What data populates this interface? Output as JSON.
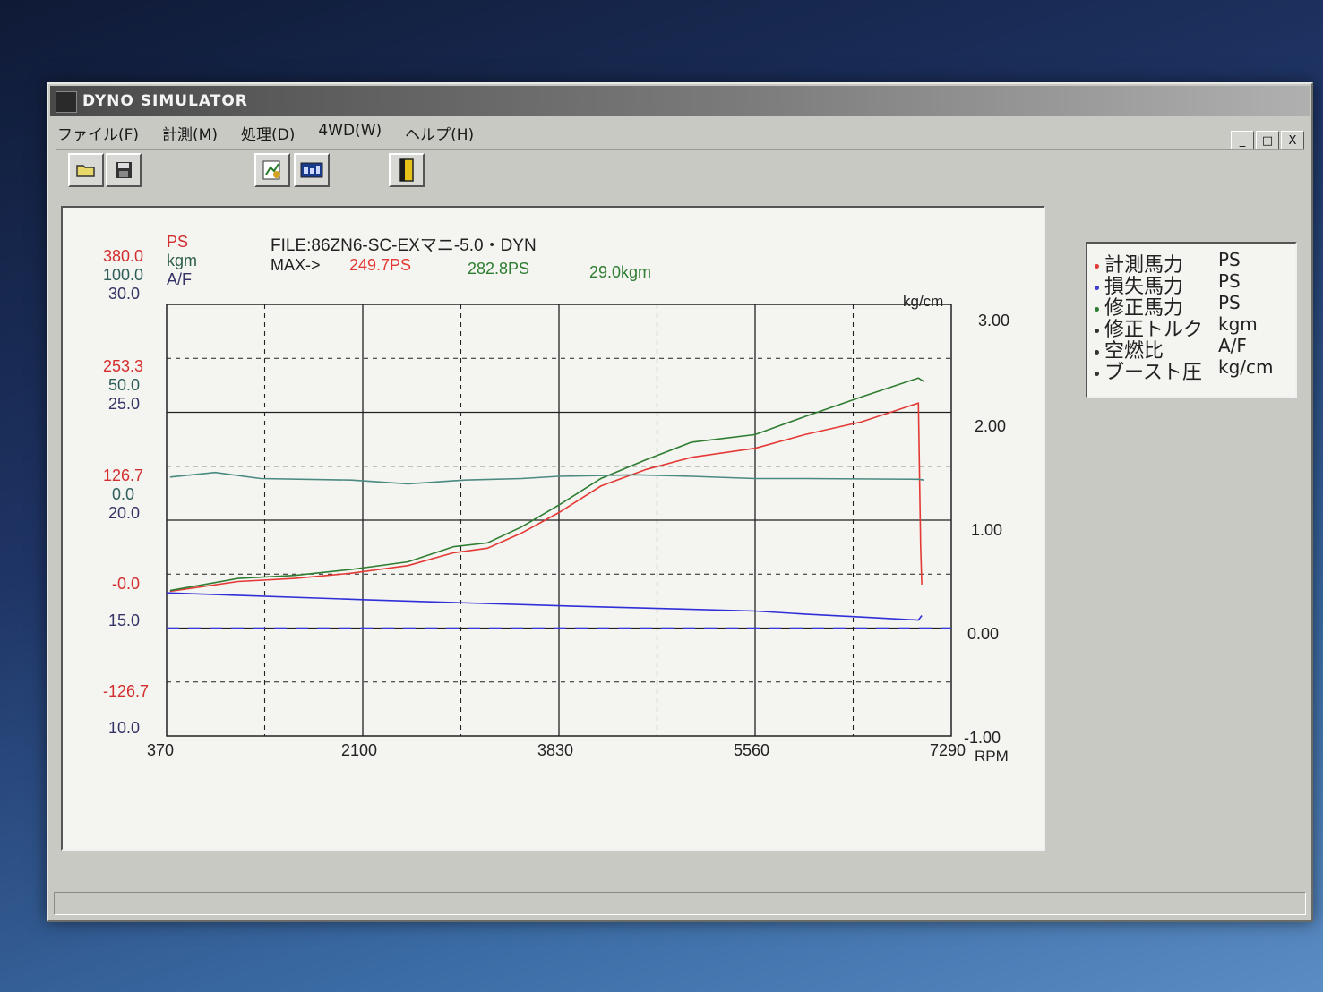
{
  "window": {
    "title": "DYNO SIMULATOR",
    "controls": {
      "minimize": "_",
      "maximize": "□",
      "close": "X"
    }
  },
  "menu": [
    "ファイル(F)",
    "計測(M)",
    "処理(D)",
    "4WD(W)",
    "ヘルプ(H)"
  ],
  "toolbar": {
    "buttons": [
      "open-folder-icon",
      "save-disk-icon",
      "measure-icon",
      "monitor-icon",
      "exit-door-icon"
    ]
  },
  "header": {
    "file_line": "FILE:86ZN6-SC-EXマニ-5.0・DYN",
    "max_label": "MAX->",
    "max_measured": "249.7PS",
    "max_corrected": "282.8PS",
    "max_torque": "29.0kgm"
  },
  "left_axis": {
    "units": [
      "PS",
      "kgm",
      "A/F"
    ],
    "ps": [
      "380.0",
      "253.3",
      "126.7",
      "-0.0",
      "-126.7"
    ],
    "kgm": [
      "100.0",
      "50.0",
      "0.0"
    ],
    "af": [
      "30.0",
      "25.0",
      "20.0",
      "15.0",
      "10.0"
    ]
  },
  "right_axis": {
    "unit": "kg/cm",
    "ticks": [
      "3.00",
      "2.00",
      "1.00",
      "0.00",
      "-1.00"
    ],
    "x_unit": "RPM"
  },
  "legend": [
    {
      "name": "計測馬力",
      "unit": "PS",
      "color": "#e53935"
    },
    {
      "name": "損失馬力",
      "unit": "PS",
      "color": "#3b3bd6"
    },
    {
      "name": "修正馬力",
      "unit": "PS",
      "color": "#2e7d32"
    },
    {
      "name": "修正トルク",
      "unit": "kgm",
      "color": "#333333"
    },
    {
      "name": "空燃比",
      "unit": "A/F",
      "color": "#333333"
    },
    {
      "name": "ブースト圧",
      "unit": "kg/cm",
      "color": "#333333"
    }
  ],
  "colors": {
    "measured": "#e53935",
    "corrected": "#2e7d32",
    "loss": "#2f2fd8",
    "boost": "#3a3ae0",
    "torque_af": "#4a8a80",
    "ps_labels": "#d32f2f",
    "kgm_labels": "#2e7d5a",
    "af_labels": "#333366"
  },
  "chart_data": {
    "type": "line",
    "x_label": "RPM",
    "x_ticks": [
      "370",
      "2100",
      "3830",
      "5560",
      "7290"
    ],
    "xlim": [
      370,
      7290
    ],
    "ylim_ps": [
      -190,
      380
    ],
    "ylim_boost": [
      -1.0,
      3.0
    ],
    "series": [
      {
        "name": "計測馬力",
        "unit": "PS",
        "x": [
          400,
          1000,
          1500,
          2000,
          2500,
          2900,
          3200,
          3500,
          3830,
          4200,
          4600,
          5000,
          5560,
          6000,
          6500,
          7000,
          7020,
          7030
        ],
        "y": [
          1,
          14,
          18,
          25,
          35,
          52,
          58,
          78,
          105,
          140,
          162,
          178,
          190,
          208,
          225,
          249.7,
          60,
          10
        ]
      },
      {
        "name": "修正馬力",
        "unit": "PS",
        "x": [
          400,
          1000,
          1500,
          2000,
          2500,
          2900,
          3200,
          3500,
          3830,
          4200,
          4600,
          5000,
          5560,
          6000,
          6500,
          7000,
          7050
        ],
        "y": [
          2,
          18,
          22,
          30,
          40,
          60,
          65,
          86,
          115,
          150,
          175,
          198,
          208,
          232,
          258,
          282.8,
          278
        ]
      },
      {
        "name": "修正トルク/空燃比",
        "unit": "kgm",
        "x": [
          400,
          800,
          1200,
          2000,
          2500,
          3000,
          3500,
          3830,
          4500,
          5000,
          5560,
          6000,
          7000,
          7050
        ],
        "y": [
          152,
          158,
          150,
          148,
          143,
          148,
          150,
          153,
          155,
          153,
          150,
          150,
          149,
          148
        ]
      },
      {
        "name": "損失馬力",
        "unit": "PS",
        "x": [
          370,
          2100,
          3830,
          5560,
          6000,
          6500,
          7000,
          7030
        ],
        "y": [
          -1,
          -10,
          -18,
          -25,
          -29,
          -33,
          -37,
          -31
        ]
      },
      {
        "name": "ブースト圧",
        "unit": "kg/cm",
        "x": [
          370,
          7290
        ],
        "y": [
          0.0,
          0.0
        ]
      }
    ]
  }
}
